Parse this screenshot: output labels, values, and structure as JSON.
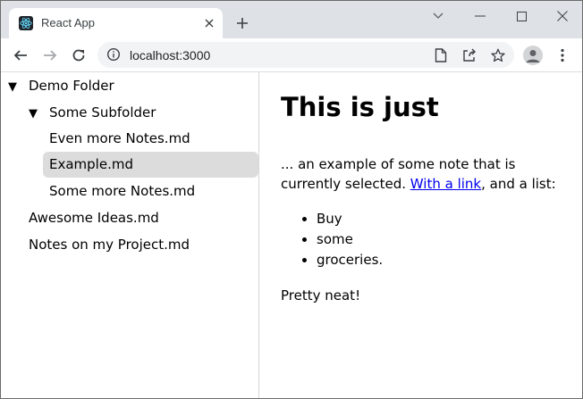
{
  "browser": {
    "tab_title": "React App",
    "url": "localhost:3000"
  },
  "sidebar": {
    "items": [
      {
        "label": "Demo Folder",
        "caret": "▼",
        "level": 0,
        "selected": false
      },
      {
        "label": "Some Subfolder",
        "caret": "▼",
        "level": 1,
        "selected": false
      },
      {
        "label": "Even more Notes.md",
        "level": 2,
        "selected": false
      },
      {
        "label": "Example.md",
        "level": 2,
        "selected": true
      },
      {
        "label": "Some more Notes.md",
        "level": 2,
        "selected": false
      },
      {
        "label": "Awesome Ideas.md",
        "level": 1,
        "selected": false
      },
      {
        "label": "Notes on my Project.md",
        "level": 1,
        "selected": false
      }
    ]
  },
  "note": {
    "heading": "This is just",
    "para_before_link": "... an example of some note that is currently selected. ",
    "link_text": "With a link",
    "para_after_link": ", and a list:",
    "list": [
      "Buy",
      "some",
      "groceries."
    ],
    "closing": "Pretty neat!"
  },
  "colors": {
    "tabstrip": "#dee1e6",
    "selected_row": "#dcdcdc",
    "link": "#0000ee"
  }
}
